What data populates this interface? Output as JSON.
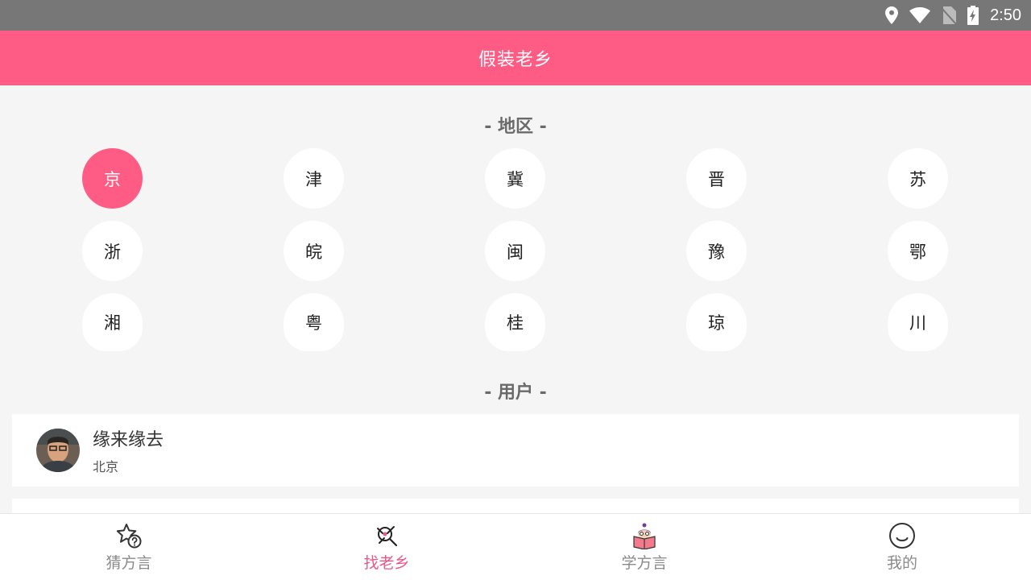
{
  "status_bar": {
    "time": "2:50"
  },
  "app_bar": {
    "title": "假装老乡"
  },
  "sections": {
    "region_title": "- 地区 -",
    "user_title": "- 用户 -"
  },
  "regions": [
    "京",
    "津",
    "冀",
    "晋",
    "苏",
    "浙",
    "皖",
    "闽",
    "豫",
    "鄂",
    "湘",
    "粤",
    "桂",
    "琼",
    "川"
  ],
  "selected_region": "京",
  "users": [
    {
      "name": "缘来缘去",
      "region": "北京"
    }
  ],
  "nav": [
    {
      "label": "猜方言",
      "icon": "star-question-icon",
      "active": false
    },
    {
      "label": "找老乡",
      "icon": "people-search-icon",
      "active": true
    },
    {
      "label": "学方言",
      "icon": "reading-book-icon",
      "active": false
    },
    {
      "label": "我的",
      "icon": "smiley-face-icon",
      "active": false
    }
  ],
  "colors": {
    "accent": "#ff5c85",
    "status_bar": "#777777",
    "background": "#f5f5f5"
  }
}
